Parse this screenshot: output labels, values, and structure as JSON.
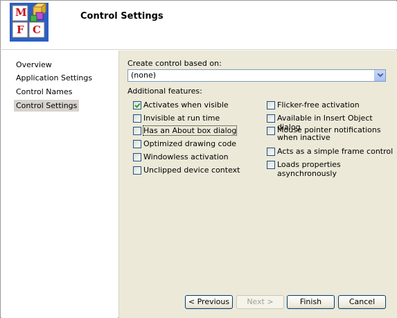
{
  "header": {
    "title": "Control Settings",
    "logo_letters": [
      "M",
      "F",
      "C"
    ]
  },
  "sidebar": {
    "items": [
      {
        "label": "Overview"
      },
      {
        "label": "Application Settings"
      },
      {
        "label": "Control Names"
      },
      {
        "label": "Control Settings",
        "active": true
      }
    ]
  },
  "main": {
    "create_label": "Create control based on:",
    "combo_value": "(none)",
    "features_label": "Additional features:",
    "left_features": [
      {
        "label": "Activates when visible",
        "checked": true
      },
      {
        "label": "Invisible at run time",
        "checked": false
      },
      {
        "label": "Has an About box dialog",
        "checked": false
      },
      {
        "label": "Optimized drawing code",
        "checked": false
      },
      {
        "label": "Windowless activation",
        "checked": false
      },
      {
        "label": "Unclipped device context",
        "checked": false
      }
    ],
    "right_features": [
      {
        "label": "Flicker-free activation",
        "checked": false
      },
      {
        "label": "Available in Insert Object dialog",
        "checked": false
      },
      {
        "label": "Mouse pointer notifications when inactive",
        "checked": false
      },
      {
        "label": "Acts as a simple frame control",
        "checked": false
      },
      {
        "label": "Loads properties asynchronously",
        "checked": false
      }
    ]
  },
  "buttons": {
    "previous": "< Previous",
    "next": "Next >",
    "finish": "Finish",
    "cancel": "Cancel"
  },
  "colors": {
    "content_bg": "#ece9d8",
    "active_nav_bg": "#d6d3ce",
    "button_border": "#003c74"
  }
}
